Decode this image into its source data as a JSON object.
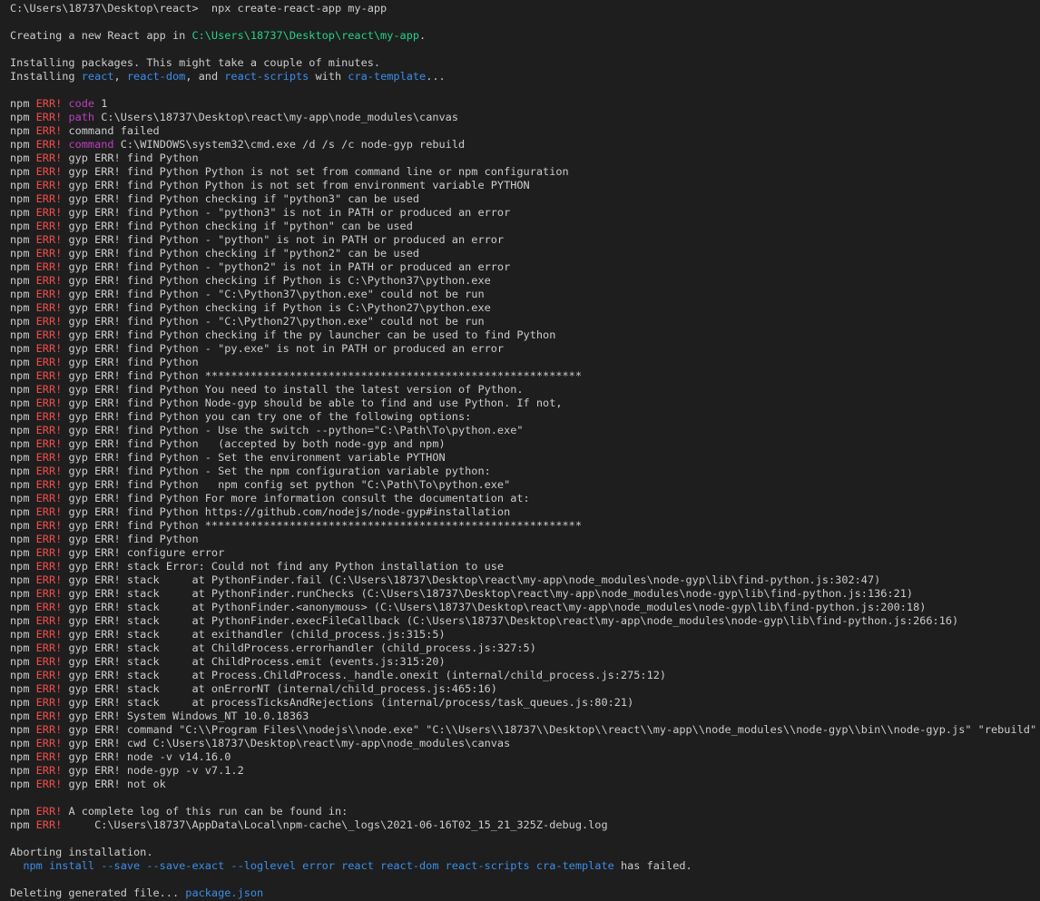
{
  "colors": {
    "background": "#1e1e1e",
    "text": "#cccccc",
    "err": "#f14c4c",
    "key": "#bc3fbc",
    "path": "#23d18b",
    "pkg": "#3b8eea"
  },
  "lines": [
    [
      {
        "t": "C:\\Users\\18737\\Desktop\\react>  npx create-react-app my-app"
      }
    ],
    [],
    [
      {
        "t": "Creating a new React app in "
      },
      {
        "t": "C:\\Users\\18737\\Desktop\\react\\my-app",
        "c": "path"
      },
      {
        "t": "."
      }
    ],
    [],
    [
      {
        "t": "Installing packages. This might take a couple of minutes."
      }
    ],
    [
      {
        "t": "Installing "
      },
      {
        "t": "react",
        "c": "pkg"
      },
      {
        "t": ", "
      },
      {
        "t": "react-dom",
        "c": "pkg"
      },
      {
        "t": ", and "
      },
      {
        "t": "react-scripts",
        "c": "pkg"
      },
      {
        "t": " with "
      },
      {
        "t": "cra-template",
        "c": "pkg"
      },
      {
        "t": "..."
      }
    ],
    [],
    [
      {
        "t": "npm "
      },
      {
        "t": "ERR!",
        "c": "err"
      },
      {
        "t": " "
      },
      {
        "t": "code",
        "c": "key"
      },
      {
        "t": " 1"
      }
    ],
    [
      {
        "t": "npm "
      },
      {
        "t": "ERR!",
        "c": "err"
      },
      {
        "t": " "
      },
      {
        "t": "path",
        "c": "key"
      },
      {
        "t": " C:\\Users\\18737\\Desktop\\react\\my-app\\node_modules\\canvas"
      }
    ],
    [
      {
        "t": "npm "
      },
      {
        "t": "ERR!",
        "c": "err"
      },
      {
        "t": " command failed"
      }
    ],
    [
      {
        "t": "npm "
      },
      {
        "t": "ERR!",
        "c": "err"
      },
      {
        "t": " "
      },
      {
        "t": "command",
        "c": "key"
      },
      {
        "t": " C:\\WINDOWS\\system32\\cmd.exe /d /s /c node-gyp rebuild"
      }
    ],
    [
      {
        "t": "npm "
      },
      {
        "t": "ERR!",
        "c": "err"
      },
      {
        "t": " gyp ERR! find Python"
      }
    ],
    [
      {
        "t": "npm "
      },
      {
        "t": "ERR!",
        "c": "err"
      },
      {
        "t": " gyp ERR! find Python Python is not set from command line or npm configuration"
      }
    ],
    [
      {
        "t": "npm "
      },
      {
        "t": "ERR!",
        "c": "err"
      },
      {
        "t": " gyp ERR! find Python Python is not set from environment variable PYTHON"
      }
    ],
    [
      {
        "t": "npm "
      },
      {
        "t": "ERR!",
        "c": "err"
      },
      {
        "t": " gyp ERR! find Python checking if \"python3\" can be used"
      }
    ],
    [
      {
        "t": "npm "
      },
      {
        "t": "ERR!",
        "c": "err"
      },
      {
        "t": " gyp ERR! find Python - \"python3\" is not in PATH or produced an error"
      }
    ],
    [
      {
        "t": "npm "
      },
      {
        "t": "ERR!",
        "c": "err"
      },
      {
        "t": " gyp ERR! find Python checking if \"python\" can be used"
      }
    ],
    [
      {
        "t": "npm "
      },
      {
        "t": "ERR!",
        "c": "err"
      },
      {
        "t": " gyp ERR! find Python - \"python\" is not in PATH or produced an error"
      }
    ],
    [
      {
        "t": "npm "
      },
      {
        "t": "ERR!",
        "c": "err"
      },
      {
        "t": " gyp ERR! find Python checking if \"python2\" can be used"
      }
    ],
    [
      {
        "t": "npm "
      },
      {
        "t": "ERR!",
        "c": "err"
      },
      {
        "t": " gyp ERR! find Python - \"python2\" is not in PATH or produced an error"
      }
    ],
    [
      {
        "t": "npm "
      },
      {
        "t": "ERR!",
        "c": "err"
      },
      {
        "t": " gyp ERR! find Python checking if Python is C:\\Python37\\python.exe"
      }
    ],
    [
      {
        "t": "npm "
      },
      {
        "t": "ERR!",
        "c": "err"
      },
      {
        "t": " gyp ERR! find Python - \"C:\\Python37\\python.exe\" could not be run"
      }
    ],
    [
      {
        "t": "npm "
      },
      {
        "t": "ERR!",
        "c": "err"
      },
      {
        "t": " gyp ERR! find Python checking if Python is C:\\Python27\\python.exe"
      }
    ],
    [
      {
        "t": "npm "
      },
      {
        "t": "ERR!",
        "c": "err"
      },
      {
        "t": " gyp ERR! find Python - \"C:\\Python27\\python.exe\" could not be run"
      }
    ],
    [
      {
        "t": "npm "
      },
      {
        "t": "ERR!",
        "c": "err"
      },
      {
        "t": " gyp ERR! find Python checking if the py launcher can be used to find Python"
      }
    ],
    [
      {
        "t": "npm "
      },
      {
        "t": "ERR!",
        "c": "err"
      },
      {
        "t": " gyp ERR! find Python - \"py.exe\" is not in PATH or produced an error"
      }
    ],
    [
      {
        "t": "npm "
      },
      {
        "t": "ERR!",
        "c": "err"
      },
      {
        "t": " gyp ERR! find Python"
      }
    ],
    [
      {
        "t": "npm "
      },
      {
        "t": "ERR!",
        "c": "err"
      },
      {
        "t": " gyp ERR! find Python **********************************************************"
      }
    ],
    [
      {
        "t": "npm "
      },
      {
        "t": "ERR!",
        "c": "err"
      },
      {
        "t": " gyp ERR! find Python You need to install the latest version of Python."
      }
    ],
    [
      {
        "t": "npm "
      },
      {
        "t": "ERR!",
        "c": "err"
      },
      {
        "t": " gyp ERR! find Python Node-gyp should be able to find and use Python. If not,"
      }
    ],
    [
      {
        "t": "npm "
      },
      {
        "t": "ERR!",
        "c": "err"
      },
      {
        "t": " gyp ERR! find Python you can try one of the following options:"
      }
    ],
    [
      {
        "t": "npm "
      },
      {
        "t": "ERR!",
        "c": "err"
      },
      {
        "t": " gyp ERR! find Python - Use the switch --python=\"C:\\Path\\To\\python.exe\""
      }
    ],
    [
      {
        "t": "npm "
      },
      {
        "t": "ERR!",
        "c": "err"
      },
      {
        "t": " gyp ERR! find Python   (accepted by both node-gyp and npm)"
      }
    ],
    [
      {
        "t": "npm "
      },
      {
        "t": "ERR!",
        "c": "err"
      },
      {
        "t": " gyp ERR! find Python - Set the environment variable PYTHON"
      }
    ],
    [
      {
        "t": "npm "
      },
      {
        "t": "ERR!",
        "c": "err"
      },
      {
        "t": " gyp ERR! find Python - Set the npm configuration variable python:"
      }
    ],
    [
      {
        "t": "npm "
      },
      {
        "t": "ERR!",
        "c": "err"
      },
      {
        "t": " gyp ERR! find Python   npm config set python \"C:\\Path\\To\\python.exe\""
      }
    ],
    [
      {
        "t": "npm "
      },
      {
        "t": "ERR!",
        "c": "err"
      },
      {
        "t": " gyp ERR! find Python For more information consult the documentation at:"
      }
    ],
    [
      {
        "t": "npm "
      },
      {
        "t": "ERR!",
        "c": "err"
      },
      {
        "t": " gyp ERR! find Python https://github.com/nodejs/node-gyp#installation"
      }
    ],
    [
      {
        "t": "npm "
      },
      {
        "t": "ERR!",
        "c": "err"
      },
      {
        "t": " gyp ERR! find Python **********************************************************"
      }
    ],
    [
      {
        "t": "npm "
      },
      {
        "t": "ERR!",
        "c": "err"
      },
      {
        "t": " gyp ERR! find Python"
      }
    ],
    [
      {
        "t": "npm "
      },
      {
        "t": "ERR!",
        "c": "err"
      },
      {
        "t": " gyp ERR! configure error"
      }
    ],
    [
      {
        "t": "npm "
      },
      {
        "t": "ERR!",
        "c": "err"
      },
      {
        "t": " gyp ERR! stack Error: Could not find any Python installation to use"
      }
    ],
    [
      {
        "t": "npm "
      },
      {
        "t": "ERR!",
        "c": "err"
      },
      {
        "t": " gyp ERR! stack     at PythonFinder.fail (C:\\Users\\18737\\Desktop\\react\\my-app\\node_modules\\node-gyp\\lib\\find-python.js:302:47)"
      }
    ],
    [
      {
        "t": "npm "
      },
      {
        "t": "ERR!",
        "c": "err"
      },
      {
        "t": " gyp ERR! stack     at PythonFinder.runChecks (C:\\Users\\18737\\Desktop\\react\\my-app\\node_modules\\node-gyp\\lib\\find-python.js:136:21)"
      }
    ],
    [
      {
        "t": "npm "
      },
      {
        "t": "ERR!",
        "c": "err"
      },
      {
        "t": " gyp ERR! stack     at PythonFinder.<anonymous> (C:\\Users\\18737\\Desktop\\react\\my-app\\node_modules\\node-gyp\\lib\\find-python.js:200:18)"
      }
    ],
    [
      {
        "t": "npm "
      },
      {
        "t": "ERR!",
        "c": "err"
      },
      {
        "t": " gyp ERR! stack     at PythonFinder.execFileCallback (C:\\Users\\18737\\Desktop\\react\\my-app\\node_modules\\node-gyp\\lib\\find-python.js:266:16)"
      }
    ],
    [
      {
        "t": "npm "
      },
      {
        "t": "ERR!",
        "c": "err"
      },
      {
        "t": " gyp ERR! stack     at exithandler (child_process.js:315:5)"
      }
    ],
    [
      {
        "t": "npm "
      },
      {
        "t": "ERR!",
        "c": "err"
      },
      {
        "t": " gyp ERR! stack     at ChildProcess.errorhandler (child_process.js:327:5)"
      }
    ],
    [
      {
        "t": "npm "
      },
      {
        "t": "ERR!",
        "c": "err"
      },
      {
        "t": " gyp ERR! stack     at ChildProcess.emit (events.js:315:20)"
      }
    ],
    [
      {
        "t": "npm "
      },
      {
        "t": "ERR!",
        "c": "err"
      },
      {
        "t": " gyp ERR! stack     at Process.ChildProcess._handle.onexit (internal/child_process.js:275:12)"
      }
    ],
    [
      {
        "t": "npm "
      },
      {
        "t": "ERR!",
        "c": "err"
      },
      {
        "t": " gyp ERR! stack     at onErrorNT (internal/child_process.js:465:16)"
      }
    ],
    [
      {
        "t": "npm "
      },
      {
        "t": "ERR!",
        "c": "err"
      },
      {
        "t": " gyp ERR! stack     at processTicksAndRejections (internal/process/task_queues.js:80:21)"
      }
    ],
    [
      {
        "t": "npm "
      },
      {
        "t": "ERR!",
        "c": "err"
      },
      {
        "t": " gyp ERR! System Windows_NT 10.0.18363"
      }
    ],
    [
      {
        "t": "npm "
      },
      {
        "t": "ERR!",
        "c": "err"
      },
      {
        "t": " gyp ERR! command \"C:\\\\Program Files\\\\nodejs\\\\node.exe\" \"C:\\\\Users\\\\18737\\\\Desktop\\\\react\\\\my-app\\\\node_modules\\\\node-gyp\\\\bin\\\\node-gyp.js\" \"rebuild\""
      }
    ],
    [
      {
        "t": "npm "
      },
      {
        "t": "ERR!",
        "c": "err"
      },
      {
        "t": " gyp ERR! cwd C:\\Users\\18737\\Desktop\\react\\my-app\\node_modules\\canvas"
      }
    ],
    [
      {
        "t": "npm "
      },
      {
        "t": "ERR!",
        "c": "err"
      },
      {
        "t": " gyp ERR! node -v v14.16.0"
      }
    ],
    [
      {
        "t": "npm "
      },
      {
        "t": "ERR!",
        "c": "err"
      },
      {
        "t": " gyp ERR! node-gyp -v v7.1.2"
      }
    ],
    [
      {
        "t": "npm "
      },
      {
        "t": "ERR!",
        "c": "err"
      },
      {
        "t": " gyp ERR! not ok"
      }
    ],
    [],
    [
      {
        "t": "npm "
      },
      {
        "t": "ERR!",
        "c": "err"
      },
      {
        "t": " A complete log of this run can be found in:"
      }
    ],
    [
      {
        "t": "npm "
      },
      {
        "t": "ERR!",
        "c": "err"
      },
      {
        "t": "     C:\\Users\\18737\\AppData\\Local\\npm-cache\\_logs\\2021-06-16T02_15_21_325Z-debug.log"
      }
    ],
    [],
    [
      {
        "t": "Aborting installation."
      }
    ],
    [
      {
        "t": "  "
      },
      {
        "t": "npm install --save --save-exact --loglevel error react react-dom react-scripts cra-template",
        "c": "pkg"
      },
      {
        "t": " has failed."
      }
    ],
    [],
    [
      {
        "t": "Deleting generated file... "
      },
      {
        "t": "package.json",
        "c": "pkg"
      }
    ]
  ]
}
